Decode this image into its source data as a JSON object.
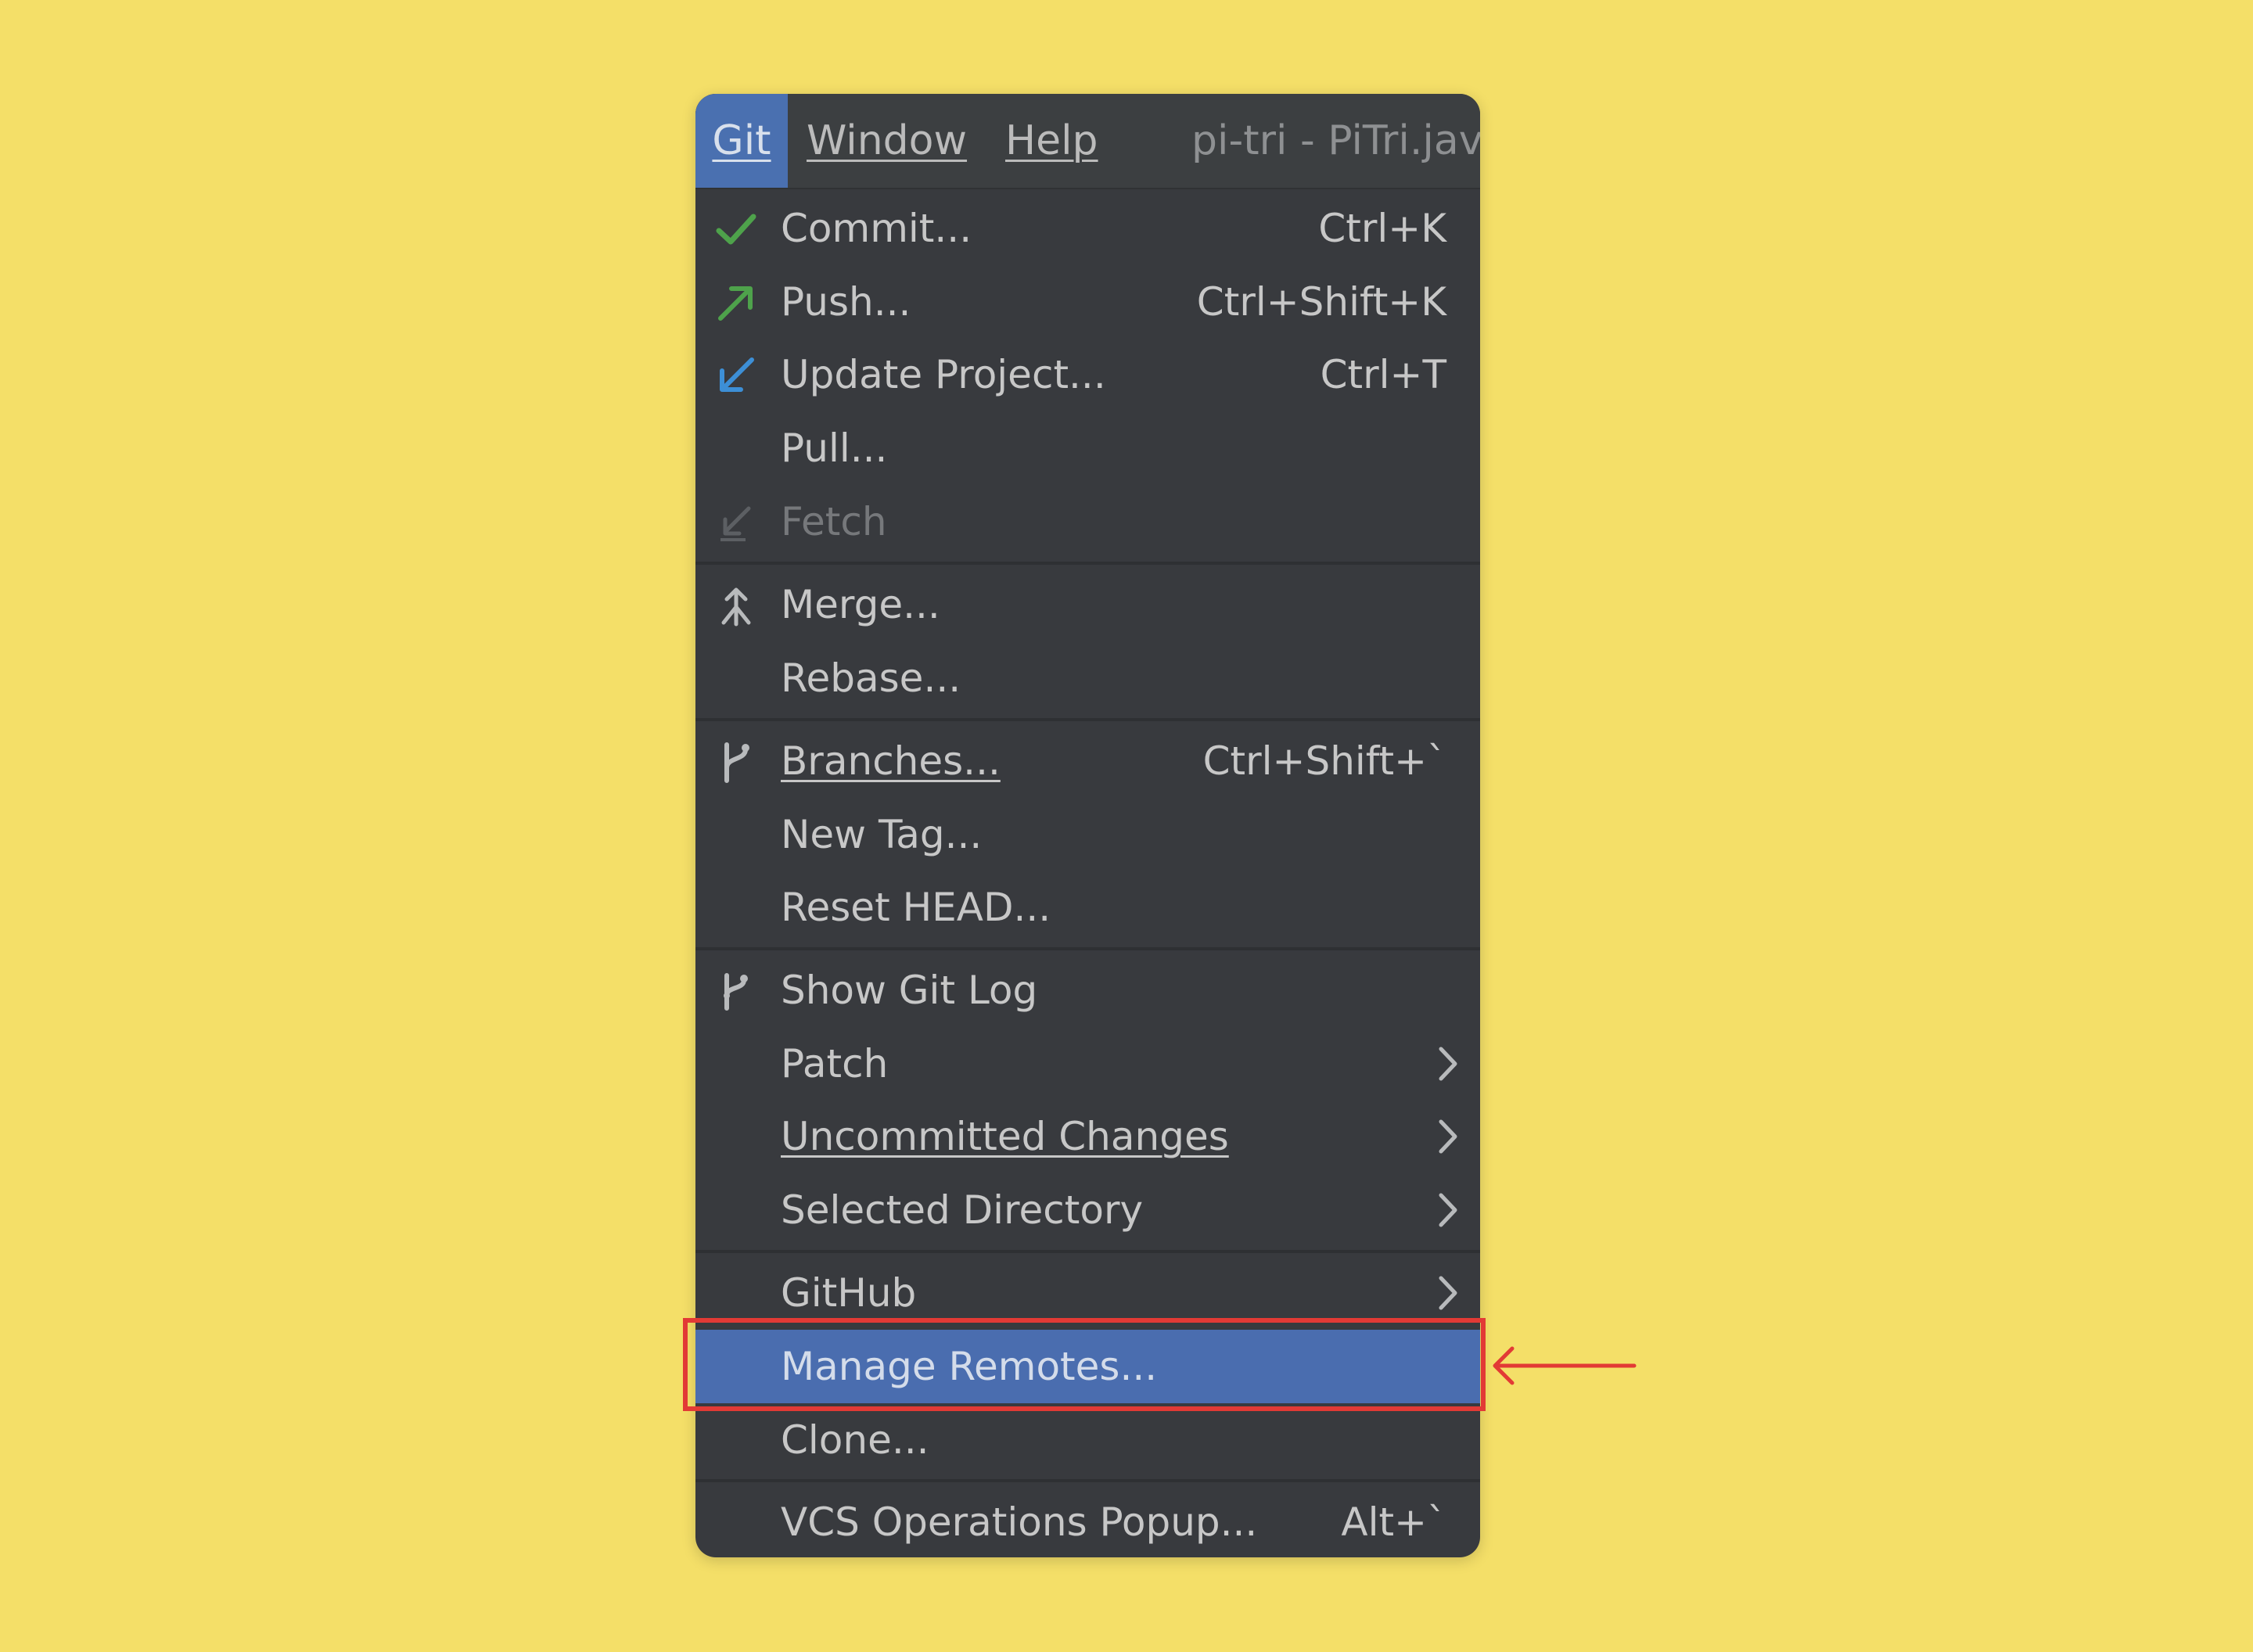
{
  "menubar": {
    "git": "Git",
    "window": "Window",
    "help": "Help",
    "title": "pi-tri - PiTri.java"
  },
  "menu": {
    "commit": {
      "label": "Commit...",
      "shortcut": "Ctrl+K",
      "icon": "check-icon",
      "icon_color": "#4EA24B"
    },
    "push": {
      "label": "Push...",
      "shortcut": "Ctrl+Shift+K",
      "icon": "push-arrow-icon",
      "icon_color": "#4EA24B"
    },
    "update": {
      "label": "Update Project...",
      "shortcut": "Ctrl+T",
      "icon": "update-arrow-icon",
      "icon_color": "#3D8FD6"
    },
    "pull": {
      "label": "Pull..."
    },
    "fetch": {
      "label": "Fetch",
      "icon": "fetch-icon",
      "state": "disabled"
    },
    "merge": {
      "label": "Merge...",
      "icon": "merge-icon"
    },
    "rebase": {
      "label": "Rebase..."
    },
    "branches": {
      "label": "Branches...",
      "shortcut": "Ctrl+Shift+`",
      "icon": "branch-icon"
    },
    "new_tag": {
      "label": "New Tag..."
    },
    "reset_head": {
      "label": "Reset HEAD..."
    },
    "show_git_log": {
      "label": "Show Git Log",
      "icon": "git-log-icon"
    },
    "patch": {
      "label": "Patch",
      "icon": "submenu-arrow-icon"
    },
    "uncommitted": {
      "label": "Uncommitted Changes",
      "icon": "submenu-arrow-icon"
    },
    "selected_directory": {
      "label": "Selected Directory",
      "icon": "submenu-arrow-icon"
    },
    "github": {
      "label": "GitHub",
      "icon": "submenu-arrow-icon"
    },
    "manage_remotes": {
      "label": "Manage Remotes...",
      "state": "selected"
    },
    "clone": {
      "label": "Clone..."
    },
    "vcs_popup": {
      "label": "VCS Operations Popup...",
      "shortcut": "Alt+`"
    }
  },
  "colors": {
    "background": "#F4DF68",
    "menu_background": "#383A3E",
    "selection": "#4A6DAF",
    "annotation": "#E23A35"
  }
}
